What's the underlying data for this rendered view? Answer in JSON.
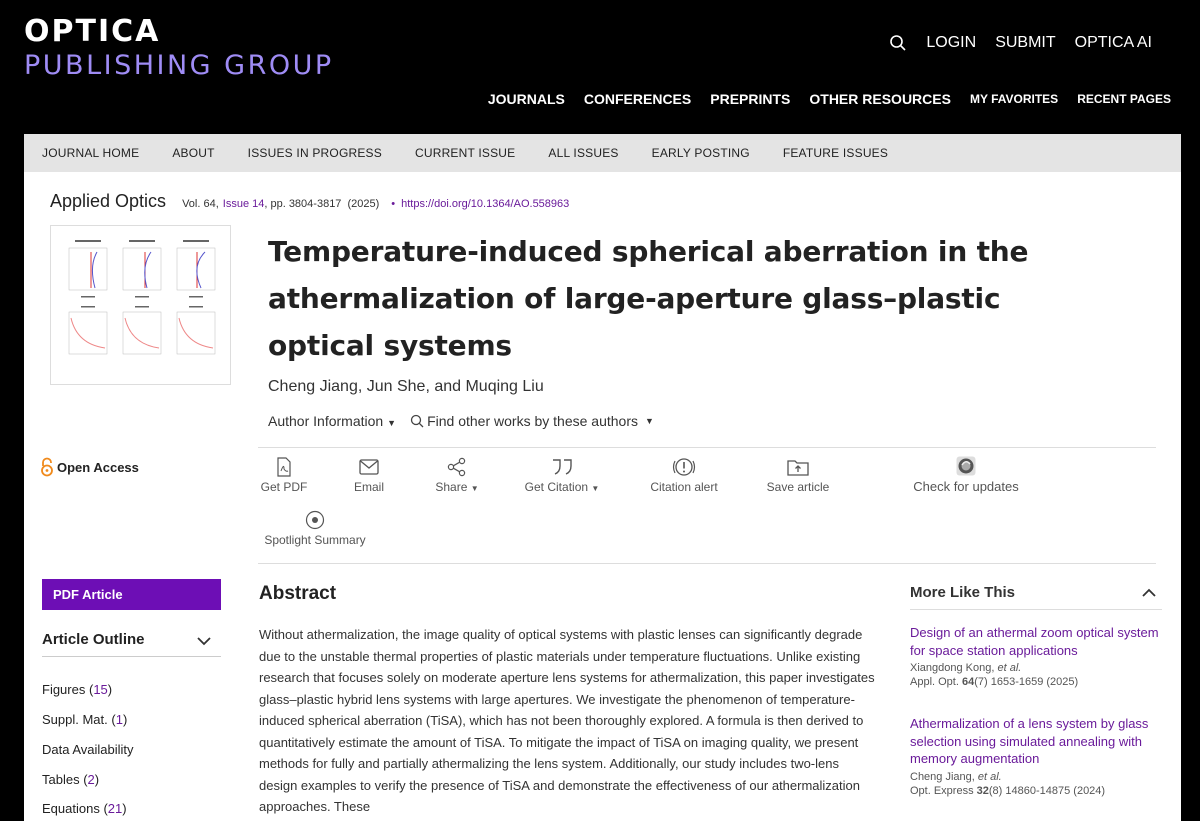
{
  "brand": {
    "line1": "OPTICA",
    "line2": "PUBLISHING GROUP"
  },
  "topnav": {
    "login": "LOGIN",
    "submit": "SUBMIT",
    "ai": "OPTICA AI"
  },
  "mainnav": {
    "journals": "JOURNALS",
    "conferences": "CONFERENCES",
    "preprints": "PREPRINTS",
    "other": "OTHER RESOURCES",
    "favorites": "MY FAVORITES",
    "recent": "RECENT PAGES"
  },
  "subnav": [
    "JOURNAL HOME",
    "ABOUT",
    "ISSUES IN PROGRESS",
    "CURRENT ISSUE",
    "ALL ISSUES",
    "EARLY POSTING",
    "FEATURE ISSUES"
  ],
  "journal": {
    "name": "Applied Optics",
    "vol": "Vol. 64,",
    "issue": "Issue 14",
    "pages": ", pp. 3804-3817",
    "year": "(2025)",
    "bullet": "•",
    "doi": "https://doi.org/10.1364/AO.558963"
  },
  "article": {
    "title": "Temperature-induced spherical aberration in the athermalization of large-aperture glass–plastic optical systems",
    "authors": "Cheng Jiang, Jun She, and Muqing Liu",
    "author_info": "Author Information",
    "find_other": "Find other works by these authors"
  },
  "open_access": "Open Access",
  "tools": {
    "pdf": "Get PDF",
    "email": "Email",
    "share": "Share",
    "citation": "Get Citation",
    "alert": "Citation alert",
    "save": "Save article",
    "updates": "Check for updates",
    "spotlight": "Spotlight Summary"
  },
  "sidebar": {
    "pdf_article": "PDF Article",
    "outline_title": "Article Outline",
    "items": [
      {
        "label": "Figures",
        "count": "15"
      },
      {
        "label": "Suppl. Mat.",
        "count": "1"
      },
      {
        "label": "Data Availability",
        "count": ""
      },
      {
        "label": "Tables",
        "count": "2"
      },
      {
        "label": "Equations",
        "count": "21"
      }
    ]
  },
  "abstract": {
    "heading": "Abstract",
    "text": "Without athermalization, the image quality of optical systems with plastic lenses can significantly degrade due to the unstable thermal properties of plastic materials under temperature fluctuations. Unlike existing research that focuses solely on moderate aperture lens systems for athermalization, this paper investigates glass–plastic hybrid lens systems with large apertures. We investigate the phenomenon of temperature-induced spherical aberration (TiSA), which has not been thoroughly explored. A formula is then derived to quantitatively estimate the amount of TiSA. To mitigate the impact of TiSA on imaging quality, we present methods for fully and partially athermalizing the lens system. Additionally, our study includes two-lens design examples to verify the presence of TiSA and demonstrate the effectiveness of our athermalization approaches. These"
  },
  "more_like_this": {
    "heading": "More Like This",
    "items": [
      {
        "title": "Design of an athermal zoom optical system for space station applications",
        "authors": "Xiangdong Kong,",
        "etal": "et al.",
        "ref_j": "Appl. Opt.",
        "ref_v": "64",
        "ref_rest": "(7) 1653-1659 (2025)"
      },
      {
        "title": "Athermalization of a lens system by glass selection using simulated annealing with memory augmentation",
        "authors": "Cheng Jiang,",
        "etal": "et al.",
        "ref_j": "Opt. Express",
        "ref_v": "32",
        "ref_rest": "(8) 14860-14875 (2024)"
      }
    ]
  }
}
